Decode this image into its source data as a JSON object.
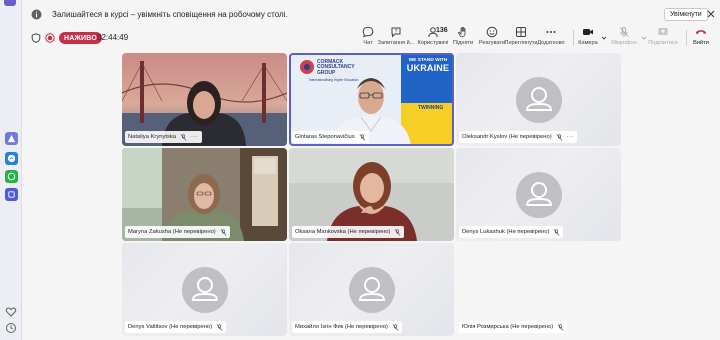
{
  "banner": {
    "message": "Залишайтеся в курсі – увімкніть сповіщення на робочому столі.",
    "enable_label": "Увімкнути"
  },
  "header": {
    "live_label": "НАЖИВО",
    "timer": "02:44:49"
  },
  "toolbar": {
    "chat": "Чат",
    "recording": "Запитання й...",
    "people": "Користувачі",
    "people_count": "136",
    "raise": "Підняти",
    "react": "Реагувати",
    "view": "Переглянути",
    "more": "Додатково",
    "camera": "Камера",
    "mic": "Мікрофон",
    "share": "Поділитися",
    "leave": "Вийти"
  },
  "participants": [
    {
      "name": "Nataliya Krynytska",
      "video": true,
      "more": "···"
    },
    {
      "name": "Gintaras Steponavičius",
      "video": true,
      "more": ""
    },
    {
      "name": "Oleksandr Kyslov (Не перевірено)",
      "video": false,
      "more": "···"
    },
    {
      "name": "Maryna Zakusha (Не перевірено)",
      "video": true,
      "more": ""
    },
    {
      "name": "Oksana Mankovska (Не перевірено)",
      "video": true,
      "more": ""
    },
    {
      "name": "Denys Lukashuk (Не перевірено)",
      "video": false,
      "more": ""
    },
    {
      "name": "Denys Vatlitsov (Не перевірено)",
      "video": false,
      "more": ""
    },
    {
      "name": "Михайло Ізгін Фик (Не перевірено)",
      "video": false,
      "more": ""
    },
    {
      "name": "Юлія Розмирська (Не перевірено)",
      "video": false,
      "more": ""
    }
  ],
  "slide": {
    "org_line1": "CORMACK",
    "org_line2": "CONSULTANCY",
    "org_line3": "GROUP",
    "org_sub": "Internationalising Higher Education",
    "banner_line1": "WE STAND WITH",
    "banner_line2": "UKRAINE",
    "twinning": "TWINNING"
  },
  "colors": {
    "accent": "#5b5fc7",
    "live": "#c4314b",
    "leave": "#c4314b"
  }
}
